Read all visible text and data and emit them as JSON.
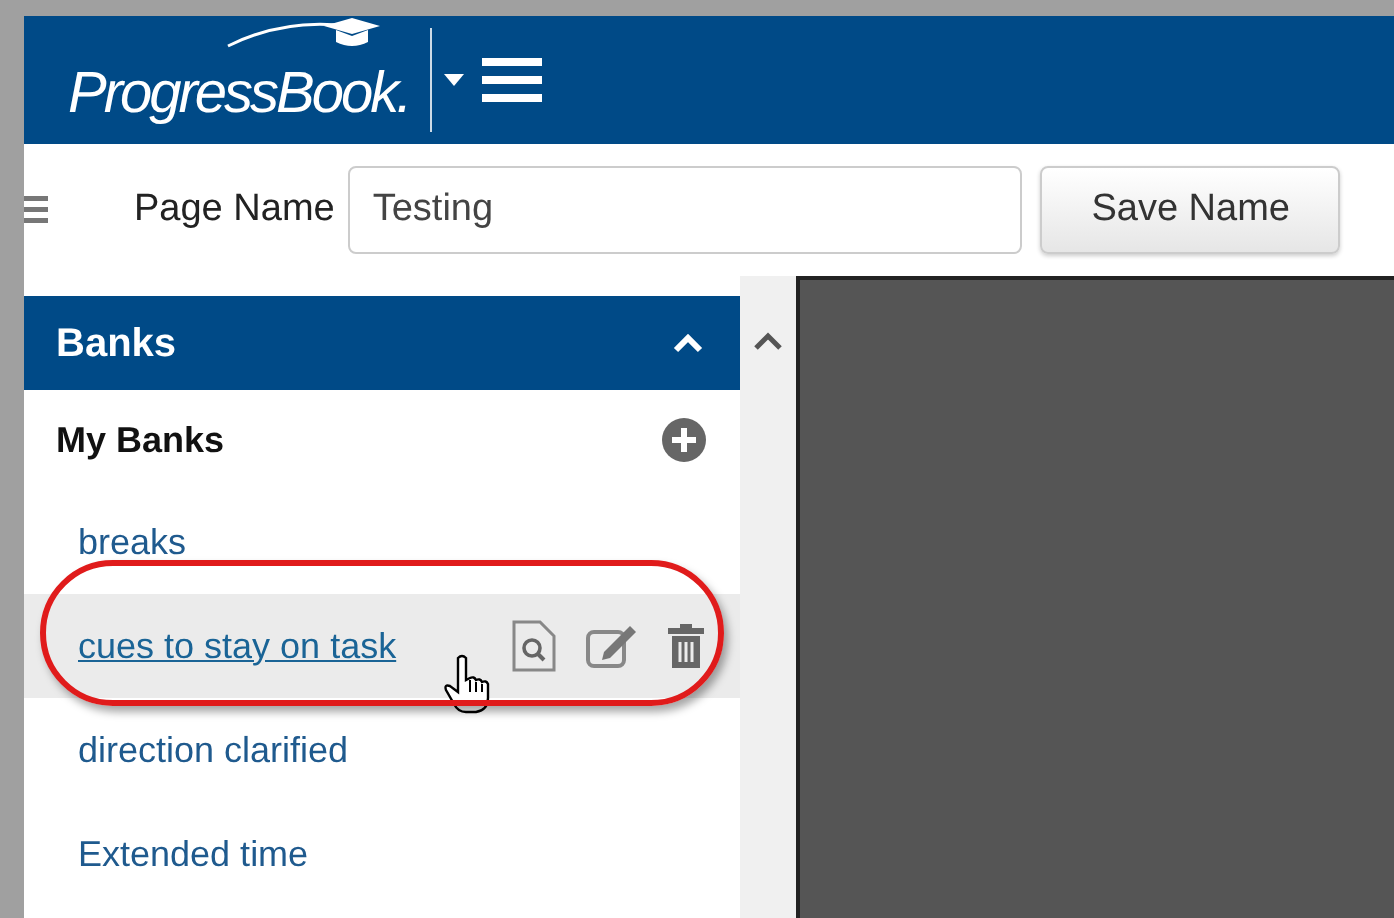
{
  "header": {
    "logo": "ProgressBook."
  },
  "toolbar": {
    "label": "Page Name",
    "page_name": {
      "value": "Testing"
    },
    "save_button": "Save Name"
  },
  "banks_panel": {
    "title": "Banks",
    "expanded": true,
    "section": "My Banks",
    "items": [
      {
        "label": "breaks",
        "hovered": false
      },
      {
        "label": "cues to stay on task",
        "hovered": true
      },
      {
        "label": "direction clarified",
        "hovered": false
      },
      {
        "label": "Extended time",
        "hovered": false
      }
    ]
  }
}
